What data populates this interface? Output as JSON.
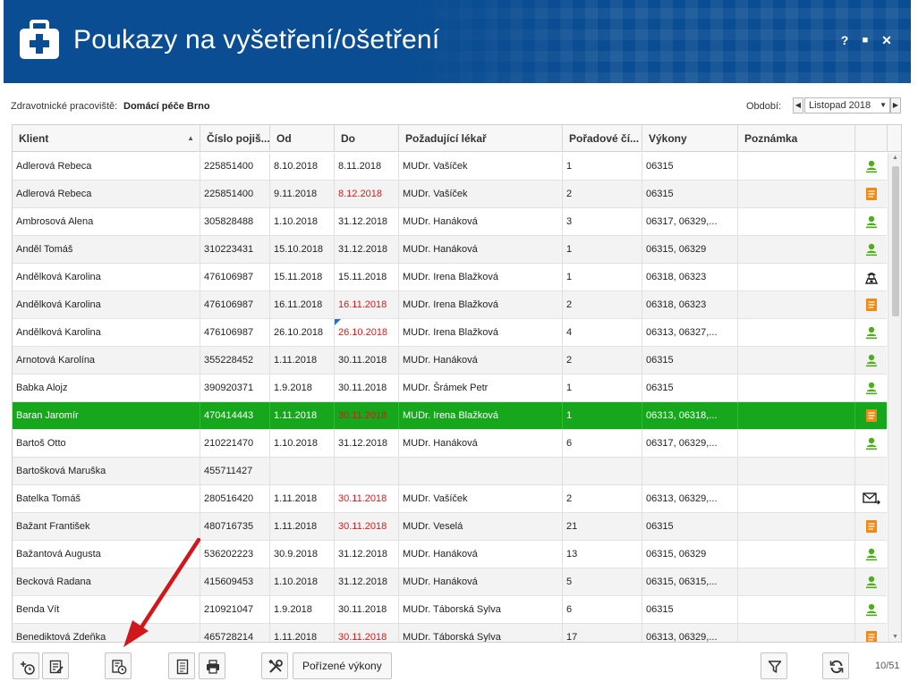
{
  "window": {
    "title": "Poukazy na vyšetření/ošetření",
    "help_label": "?",
    "maximize_label": "■",
    "close_label": "✕",
    "title_color": "#0b4d92"
  },
  "info": {
    "workplace_label": "Zdravotnické pracoviště:",
    "workplace_value": "Domácí péče Brno",
    "period_label": "Období:",
    "period_value": "Listopad 2018",
    "prev_label": "◀",
    "next_label": "▶",
    "caret": "▼"
  },
  "grid": {
    "columns": [
      {
        "label": "Klient"
      },
      {
        "label": "Číslo pojiš..."
      },
      {
        "label": "Od"
      },
      {
        "label": "Do"
      },
      {
        "label": "Požadující lékař"
      },
      {
        "label": "Pořadové čí..."
      },
      {
        "label": "Výkony"
      },
      {
        "label": "Poznámka"
      },
      {
        "label": ""
      }
    ],
    "sort_caret": "▲",
    "rows": [
      {
        "klient": "Adlerová Rebeca",
        "cislo": "225851400",
        "od": "8.10.2018",
        "do": "8.11.2018",
        "do_red": false,
        "lekar": "MUDr. Vašíček",
        "poradi": "1",
        "vykony": "06315",
        "poznamka": "",
        "icon": "person-icon"
      },
      {
        "klient": "Adlerová Rebeca",
        "cislo": "225851400",
        "od": "9.11.2018",
        "do": "8.12.2018",
        "do_red": true,
        "lekar": "MUDr. Vašíček",
        "poradi": "2",
        "vykony": "06315",
        "poznamka": "",
        "icon": "document-icon"
      },
      {
        "klient": "Ambrosová Alena",
        "cislo": "305828488",
        "od": "1.10.2018",
        "do": "31.12.2018",
        "do_red": false,
        "lekar": "MUDr. Hanáková",
        "poradi": "3",
        "vykony": "06317, 06329,...",
        "poznamka": "",
        "icon": "person-icon"
      },
      {
        "klient": "Anděl Tomáš",
        "cislo": "310223431",
        "od": "15.10.2018",
        "do": "31.12.2018",
        "do_red": false,
        "lekar": "MUDr. Hanáková",
        "poradi": "1",
        "vykony": "06315, 06329",
        "poznamka": "",
        "icon": "person-icon"
      },
      {
        "klient": "Andělková Karolina",
        "cislo": "476106987",
        "od": "15.11.2018",
        "do": "15.11.2018",
        "do_red": false,
        "lekar": "MUDr. Irena Blažková",
        "poradi": "1",
        "vykony": "06318, 06323",
        "poznamka": "",
        "icon": "agent-icon"
      },
      {
        "klient": "Andělková Karolina",
        "cislo": "476106987",
        "od": "16.11.2018",
        "do": "16.11.2018",
        "do_red": true,
        "lekar": "MUDr. Irena Blažková",
        "poradi": "2",
        "vykony": "06318, 06323",
        "poznamka": "",
        "icon": "document-icon"
      },
      {
        "klient": "Andělková Karolina",
        "cislo": "476106987",
        "od": "26.10.2018",
        "do": "26.10.2018",
        "do_red": true,
        "do_mark": true,
        "lekar": "MUDr. Irena Blažková",
        "poradi": "4",
        "vykony": "06313, 06327,...",
        "poznamka": "",
        "icon": "person-icon"
      },
      {
        "klient": "Arnotová Karolína",
        "cislo": "355228452",
        "od": "1.11.2018",
        "do": "30.11.2018",
        "do_red": false,
        "lekar": "MUDr. Hanáková",
        "poradi": "2",
        "vykony": "06315",
        "poznamka": "",
        "icon": "person-icon"
      },
      {
        "klient": "Babka Alojz",
        "cislo": "390920371",
        "od": "1.9.2018",
        "do": "30.11.2018",
        "do_red": false,
        "lekar": "MUDr. Šrámek Petr",
        "poradi": "1",
        "vykony": "06315",
        "poznamka": "",
        "icon": "person-icon"
      },
      {
        "klient": "Baran Jaromír",
        "cislo": "470414443",
        "od": "1.11.2018",
        "do": "30.11.2018",
        "do_red": true,
        "lekar": "MUDr. Irena Blažková",
        "poradi": "1",
        "vykony": "06313, 06318,...",
        "poznamka": "",
        "icon": "document-icon",
        "selected": true
      },
      {
        "klient": "Bartoš Otto",
        "cislo": "210221470",
        "od": "1.10.2018",
        "do": "31.12.2018",
        "do_red": false,
        "lekar": "MUDr. Hanáková",
        "poradi": "6",
        "vykony": "06317, 06329,...",
        "poznamka": "",
        "icon": "person-icon"
      },
      {
        "klient": "Bartošková Maruška",
        "cislo": "455711427",
        "od": "",
        "do": "",
        "do_red": false,
        "lekar": "",
        "poradi": "",
        "vykony": "",
        "poznamka": "",
        "icon": ""
      },
      {
        "klient": "Batelka Tomáš",
        "cislo": "280516420",
        "od": "1.11.2018",
        "do": "30.11.2018",
        "do_red": true,
        "lekar": "MUDr. Vašíček",
        "poradi": "2",
        "vykony": "06313, 06329,...",
        "poznamka": "",
        "icon": "mail-icon"
      },
      {
        "klient": "Bažant František",
        "cislo": "480716735",
        "od": "1.11.2018",
        "do": "30.11.2018",
        "do_red": true,
        "lekar": "MUDr. Veselá",
        "poradi": "21",
        "vykony": "06315",
        "poznamka": "",
        "icon": "document-icon"
      },
      {
        "klient": "Bažantová Augusta",
        "cislo": "536202223",
        "od": "30.9.2018",
        "do": "31.12.2018",
        "do_red": false,
        "lekar": "MUDr. Hanáková",
        "poradi": "13",
        "vykony": "06315, 06329",
        "poznamka": "",
        "icon": "person-icon"
      },
      {
        "klient": "Becková Radana",
        "cislo": "415609453",
        "od": "1.10.2018",
        "do": "31.12.2018",
        "do_red": false,
        "lekar": "MUDr. Hanáková",
        "poradi": "5",
        "vykony": "06315, 06315,...",
        "poznamka": "",
        "icon": "person-icon"
      },
      {
        "klient": "Benda Vít",
        "cislo": "210921047",
        "od": "1.9.2018",
        "do": "30.11.2018",
        "do_red": false,
        "lekar": "MUDr. Táborská Sylva",
        "poradi": "6",
        "vykony": "06315",
        "poznamka": "",
        "icon": "person-icon"
      },
      {
        "klient": "Benediktová Zdeňka",
        "cislo": "465728214",
        "od": "1.11.2018",
        "do": "30.11.2018",
        "do_red": true,
        "lekar": "MUDr. Táborská Sylva",
        "poradi": "17",
        "vykony": "06313, 06329,...",
        "poznamka": "",
        "icon": "document-icon"
      }
    ]
  },
  "toolbar": {
    "porizene_label": "Pořízené výkony",
    "counter": "10/51"
  },
  "colors": {
    "selected_row": "#17a71c",
    "red_date": "#d9191c",
    "person_icon": "#4caf1a",
    "document_icon": "#f08a12"
  }
}
